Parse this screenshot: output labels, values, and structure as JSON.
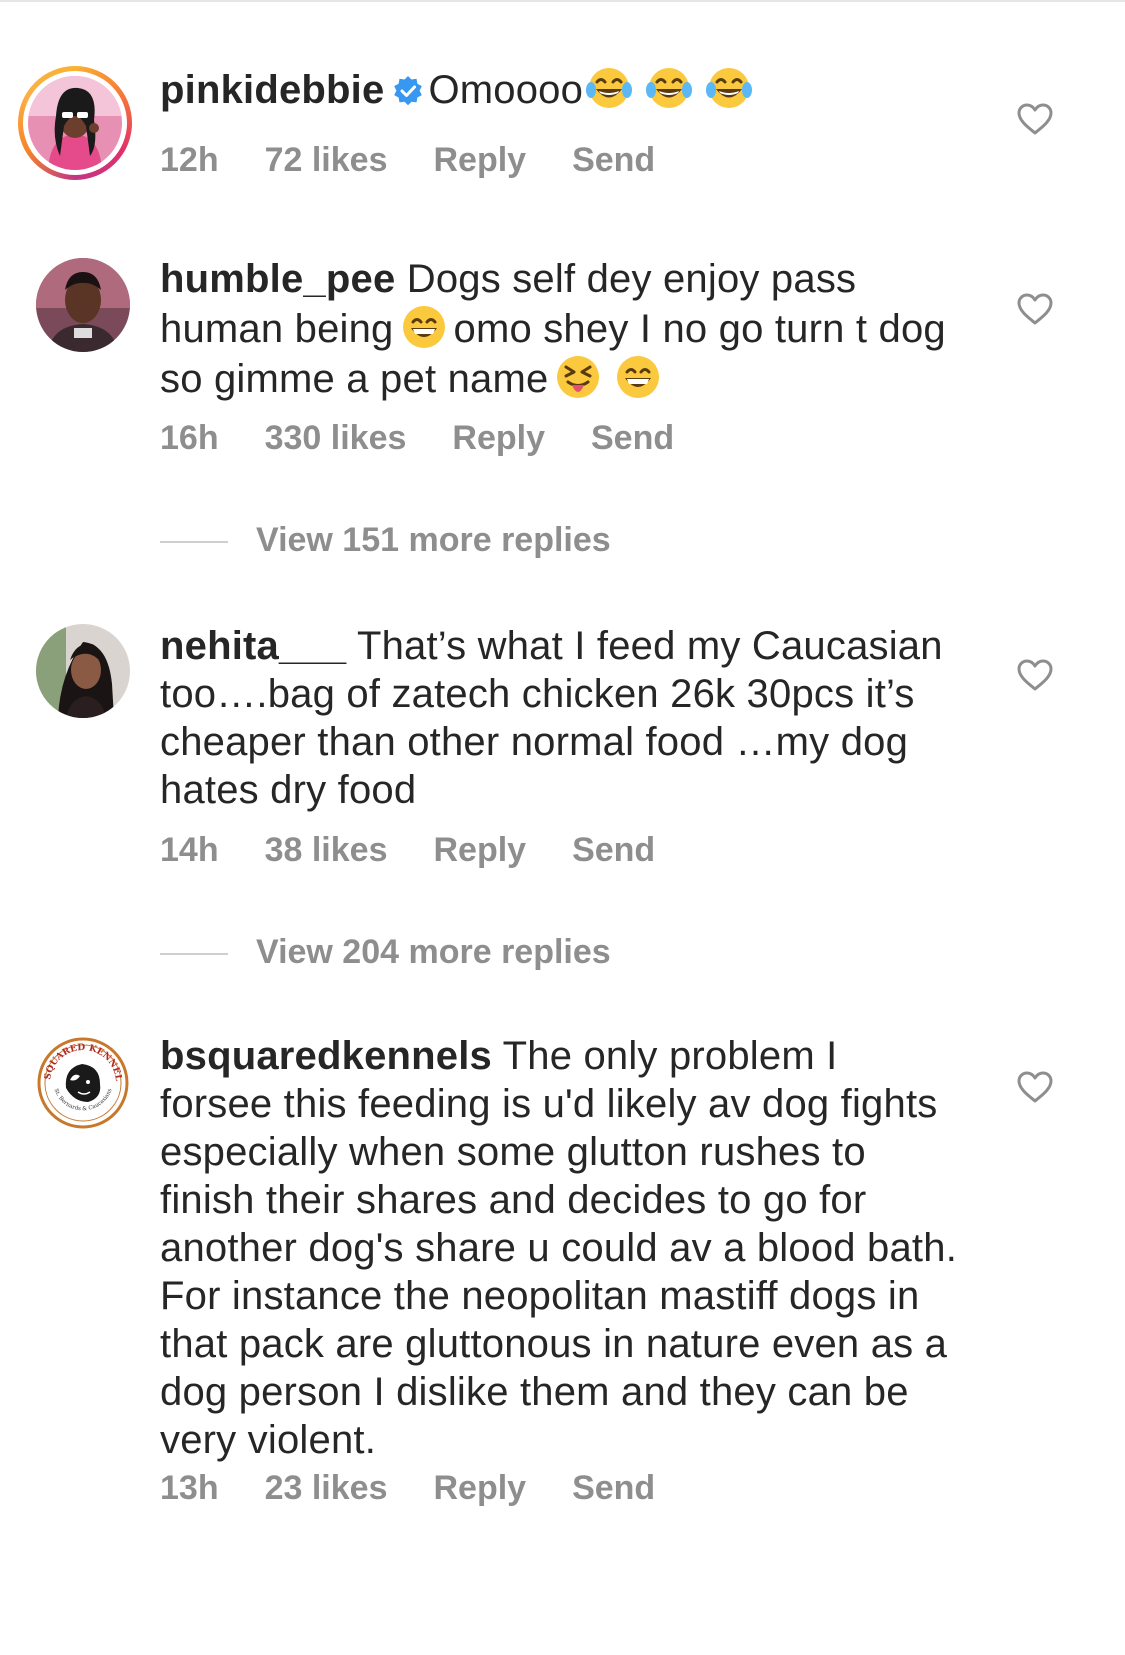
{
  "comments": [
    {
      "username": "pinkidebbie",
      "verified": true,
      "text": "Omoooo",
      "time": "12h",
      "likes": "72 likes",
      "reply": "Reply",
      "send": "Send"
    },
    {
      "username": "humble_pee",
      "text_part1": "Dogs self dey enjoy pass human being",
      "text_part2": "omo shey I no go turn t dog so gimme a pet name",
      "time": "16h",
      "likes": "330 likes",
      "reply": "Reply",
      "send": "Send",
      "view_replies": "View 151 more replies"
    },
    {
      "username": "nehita___",
      "text": "That’s what I feed my Caucasian too….bag of zatech chicken 26k 30pcs it’s cheaper than other normal food …my dog hates dry food",
      "time": "14h",
      "likes": "38 likes",
      "reply": "Reply",
      "send": "Send",
      "view_replies": "View 204 more replies"
    },
    {
      "username": "bsquaredkennels",
      "avatar_logo_text": "BSQUARED KENNELS",
      "avatar_logo_subtext": "St. Bernards & Caucasians",
      "text": "The only problem I forsee  this feeding is u'd likely av dog fights especially when some glutton rushes to finish their shares and decides to go for another dog's share u could av a blood bath. For instance the neopolitan mastiff dogs in that pack  are gluttonous in nature even as a dog person I dislike them and they can be very violent.",
      "time": "13h",
      "likes": "23 likes",
      "reply": "Reply",
      "send": "Send"
    }
  ],
  "icons": {
    "verified": "verified-badge-icon",
    "heart": "heart-outline-icon",
    "laugh": "face-with-tears-of-joy-emoji",
    "grin": "grinning-face-emoji",
    "tongue": "squinting-face-with-tongue-emoji"
  },
  "colors": {
    "text": "#262626",
    "secondary": "#8e8e8e",
    "verified_blue": "#3897f0"
  }
}
